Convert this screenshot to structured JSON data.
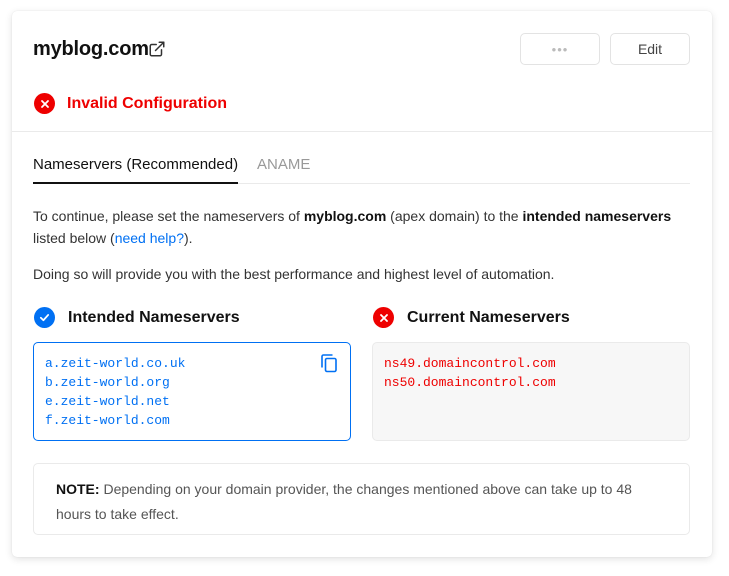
{
  "header": {
    "domain": "myblog.com",
    "more_label": "•••",
    "edit_label": "Edit"
  },
  "status": {
    "text": "Invalid Configuration"
  },
  "tabs": [
    {
      "label": "Nameservers (Recommended)",
      "active": true
    },
    {
      "label": "ANAME",
      "active": false
    }
  ],
  "instructions": {
    "p1_before": "To continue, please set the nameservers of ",
    "p1_domain": "myblog.com",
    "p1_middle": " (apex domain) to the ",
    "p1_bold": "intended nameservers",
    "p1_after_bold": " listed below (",
    "p1_link": "need help?",
    "p1_end": ").",
    "p2": "Doing so will provide you with the best performance and highest level of automation."
  },
  "intended": {
    "title": "Intended Nameservers",
    "nameservers": [
      "a.zeit-world.co.uk",
      "b.zeit-world.org",
      "e.zeit-world.net",
      "f.zeit-world.com"
    ]
  },
  "current": {
    "title": "Current Nameservers",
    "nameservers": [
      "ns49.domaincontrol.com",
      "ns50.domaincontrol.com"
    ]
  },
  "note": {
    "label": "NOTE:",
    "text": " Depending on your domain provider, the changes mentioned above can take up to 48 hours to take effect."
  },
  "colors": {
    "accent": "#0070f3",
    "error": "#ee0000"
  },
  "icons": {
    "external_link": "external-link-icon",
    "error": "x-circle-icon",
    "success": "check-circle-icon",
    "copy": "copy-icon"
  }
}
